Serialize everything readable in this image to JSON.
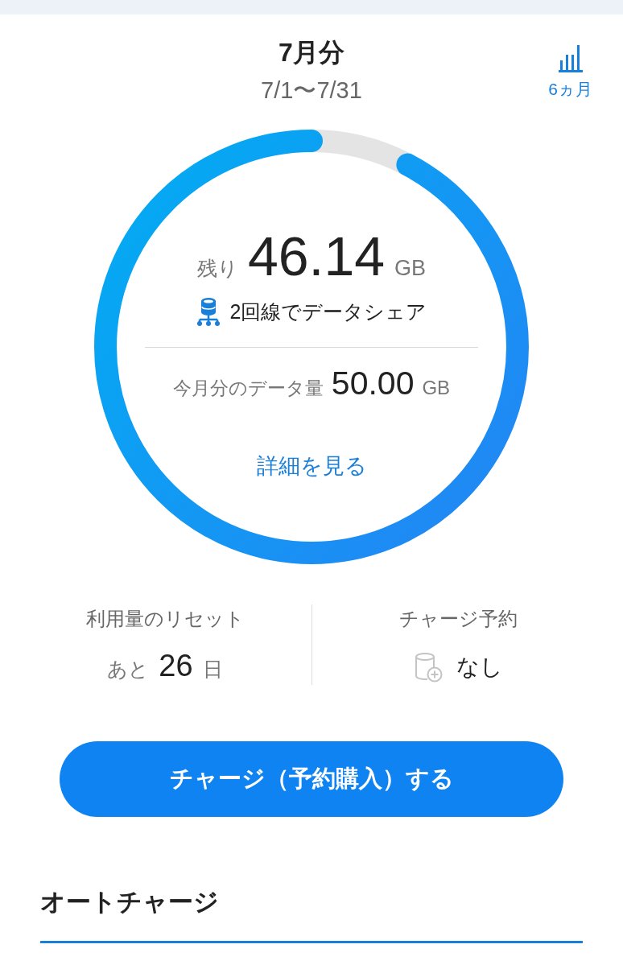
{
  "header": {
    "title": "7月分",
    "period": "7/1〜7/31",
    "history_button": {
      "label": "6ヵ月"
    }
  },
  "usage_ring": {
    "level": 0.9228,
    "remaining_label": "残り",
    "remaining_value": "46.14",
    "remaining_unit": "GB",
    "share_text": "2回線でデータシェア",
    "total_label": "今月分のデータ量",
    "total_value": "50.00",
    "total_unit": "GB",
    "details_link": "詳細を見る"
  },
  "stats": [
    {
      "kind": "countdown",
      "title": "利用量のリセット",
      "prefix": "あと",
      "value": "26",
      "suffix": "日"
    },
    {
      "kind": "reservation",
      "title": "チャージ予約",
      "value": "なし"
    }
  ],
  "charge_button": {
    "label": "チャージ（予約購入）する"
  },
  "section": {
    "title": "オートチャージ"
  }
}
